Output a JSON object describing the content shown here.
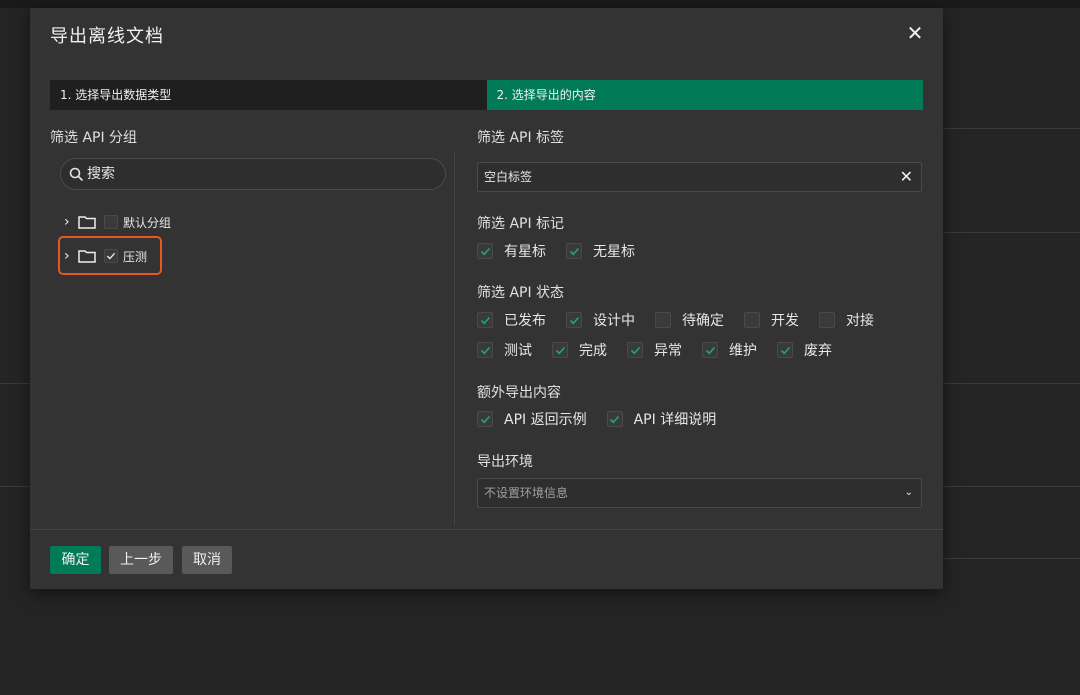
{
  "modal": {
    "title": "导出离线文档",
    "close_label": "✕"
  },
  "steps": [
    {
      "label": "1. 选择导出数据类型",
      "active": false
    },
    {
      "label": "2. 选择导出的内容",
      "active": true
    }
  ],
  "groups": {
    "label": "筛选 API 分组",
    "search_placeholder": "搜索",
    "items": [
      {
        "label": "默认分组",
        "checked": false
      },
      {
        "label": "压测",
        "checked": true
      }
    ]
  },
  "tags": {
    "label": "筛选 API 标签",
    "value": "空白标签"
  },
  "marks": {
    "label": "筛选 API 标记",
    "options": [
      {
        "label": "有星标",
        "checked": true
      },
      {
        "label": "无星标",
        "checked": true
      }
    ]
  },
  "status": {
    "label": "筛选 API 状态",
    "row1": [
      {
        "label": "已发布",
        "checked": true
      },
      {
        "label": "设计中",
        "checked": true
      },
      {
        "label": "待确定",
        "checked": false
      },
      {
        "label": "开发",
        "checked": false
      },
      {
        "label": "对接",
        "checked": false
      }
    ],
    "row2": [
      {
        "label": "测试",
        "checked": true
      },
      {
        "label": "完成",
        "checked": true
      },
      {
        "label": "异常",
        "checked": true
      },
      {
        "label": "维护",
        "checked": true
      },
      {
        "label": "废弃",
        "checked": true
      }
    ]
  },
  "extra": {
    "label": "额外导出内容",
    "options": [
      {
        "label": "API 返回示例",
        "checked": true
      },
      {
        "label": "API 详细说明",
        "checked": true
      }
    ]
  },
  "env": {
    "label": "导出环境",
    "placeholder": "不设置环境信息"
  },
  "footer": {
    "confirm": "确定",
    "prev": "上一步",
    "cancel": "取消"
  },
  "colors": {
    "accent": "#007a57",
    "highlight": "#e8571f",
    "check": "#1fa57a"
  }
}
